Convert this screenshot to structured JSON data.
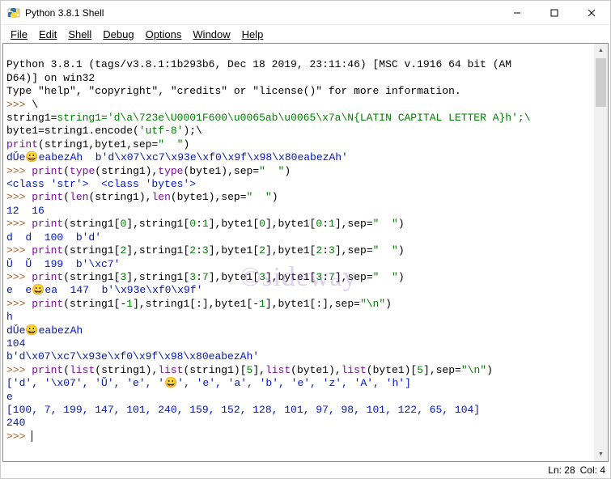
{
  "titlebar": {
    "title": "Python 3.8.1 Shell"
  },
  "menu": {
    "file": "File",
    "edit": "Edit",
    "shell": "Shell",
    "debug": "Debug",
    "options": "Options",
    "window": "Window",
    "help": "Help"
  },
  "shell": {
    "banner1": "Python 3.8.1 (tags/v3.8.1:1b293b6, Dec 18 2019, 23:11:46) [MSC v.1916 64 bit (AM",
    "banner2": "D64)] on win32",
    "banner3": "Type \"help\", \"copyright\", \"credits\" or \"license()\" for more information.",
    "p1": ">>> ",
    "p1b": "\\",
    "l2": "string1='d\\a\\723e\\U0001F600\\u0065ab\\u0065\\x7a\\N{LATIN CAPITAL LETTER A}h';\\",
    "l3": "byte1=string1.encode('utf-8');\\",
    "l4a": "print",
    "l4b": "(string1,byte1,sep=",
    "l4c": "\"  \"",
    "l4d": ")",
    "o1": "dǓe😀eabezAh  b'd\\x07\\xc7\\x93e\\xf0\\x9f\\x98\\x80eabezAh'",
    "p2": ">>> ",
    "l5a": "print",
    "l5b": "(",
    "l5c": "type",
    "l5d": "(string1),",
    "l5e": "type",
    "l5f": "(byte1),sep=",
    "l5g": "\"  \"",
    "l5h": ")",
    "o2": "<class 'str'>  <class 'bytes'>",
    "p3": ">>> ",
    "l6a": "print",
    "l6b": "(",
    "l6c": "len",
    "l6d": "(string1),",
    "l6e": "len",
    "l6f": "(byte1),sep=",
    "l6g": "\"  \"",
    "l6h": ")",
    "o3": "12  16",
    "p4": ">>> ",
    "l7a": "print",
    "l7b": "(string1[",
    "l7c": "0",
    "l7d": "],string1[",
    "l7e": "0",
    "l7f": ":",
    "l7g": "1",
    "l7h": "],byte1[",
    "l7i": "0",
    "l7j": "],byte1[",
    "l7k": "0",
    "l7l": ":",
    "l7m": "1",
    "l7n": "],sep=",
    "l7o": "\"  \"",
    "l7p": ")",
    "o4": "d  d  100  b'd'",
    "p5": ">>> ",
    "l8a": "print",
    "l8b": "(string1[",
    "l8c": "2",
    "l8d": "],string1[",
    "l8e": "2",
    "l8f": ":",
    "l8g": "3",
    "l8h": "],byte1[",
    "l8i": "2",
    "l8j": "],byte1[",
    "l8k": "2",
    "l8l": ":",
    "l8m": "3",
    "l8n": "],sep=",
    "l8o": "\"  \"",
    "l8p": ")",
    "o5": "Ǔ  Ǔ  199  b'\\xc7'",
    "p6": ">>> ",
    "l9a": "print",
    "l9b": "(string1[",
    "l9c": "3",
    "l9d": "],string1[",
    "l9e": "3",
    "l9f": ":",
    "l9g": "7",
    "l9h": "],byte1[",
    "l9i": "3",
    "l9j": "],byte1[",
    "l9k": "3",
    "l9l": ":",
    "l9m": "7",
    "l9n": "],sep=",
    "l9o": "\"  \"",
    "l9p": ")",
    "o6": "e  e😀ea  147  b'\\x93e\\xf0\\x9f'",
    "p7": ">>> ",
    "l10a": "print",
    "l10b": "(string1[-",
    "l10c": "1",
    "l10d": "],string1[:],byte1[-",
    "l10e": "1",
    "l10f": "],byte1[:],sep=",
    "l10g": "\"\\n\"",
    "l10h": ")",
    "o7a": "h",
    "o7b": "dǓe😀eabezAh",
    "o7c": "104",
    "o7d": "b'd\\x07\\xc7\\x93e\\xf0\\x9f\\x98\\x80eabezAh'",
    "p8": ">>> ",
    "l11a": "print",
    "l11b": "(",
    "l11c": "list",
    "l11d": "(string1),",
    "l11e": "list",
    "l11f": "(string1)[",
    "l11g": "5",
    "l11h": "],",
    "l11i": "list",
    "l11j": "(byte1),",
    "l11k": "list",
    "l11l": "(byte1)[",
    "l11m": "5",
    "l11n": "],sep=",
    "l11o": "\"\\n\"",
    "l11p": ")",
    "o8a": "['d', '\\x07', 'Ǔ', 'e', '😀', 'e', 'a', 'b', 'e', 'z', 'A', 'h']",
    "o8b": "e",
    "o8c": "[100, 7, 199, 147, 101, 240, 159, 152, 128, 101, 97, 98, 101, 122, 65, 104]",
    "o8d": "240",
    "p9": ">>> "
  },
  "status": {
    "ln": "Ln: 28",
    "col": "Col: 4"
  },
  "watermark": "©sideway"
}
